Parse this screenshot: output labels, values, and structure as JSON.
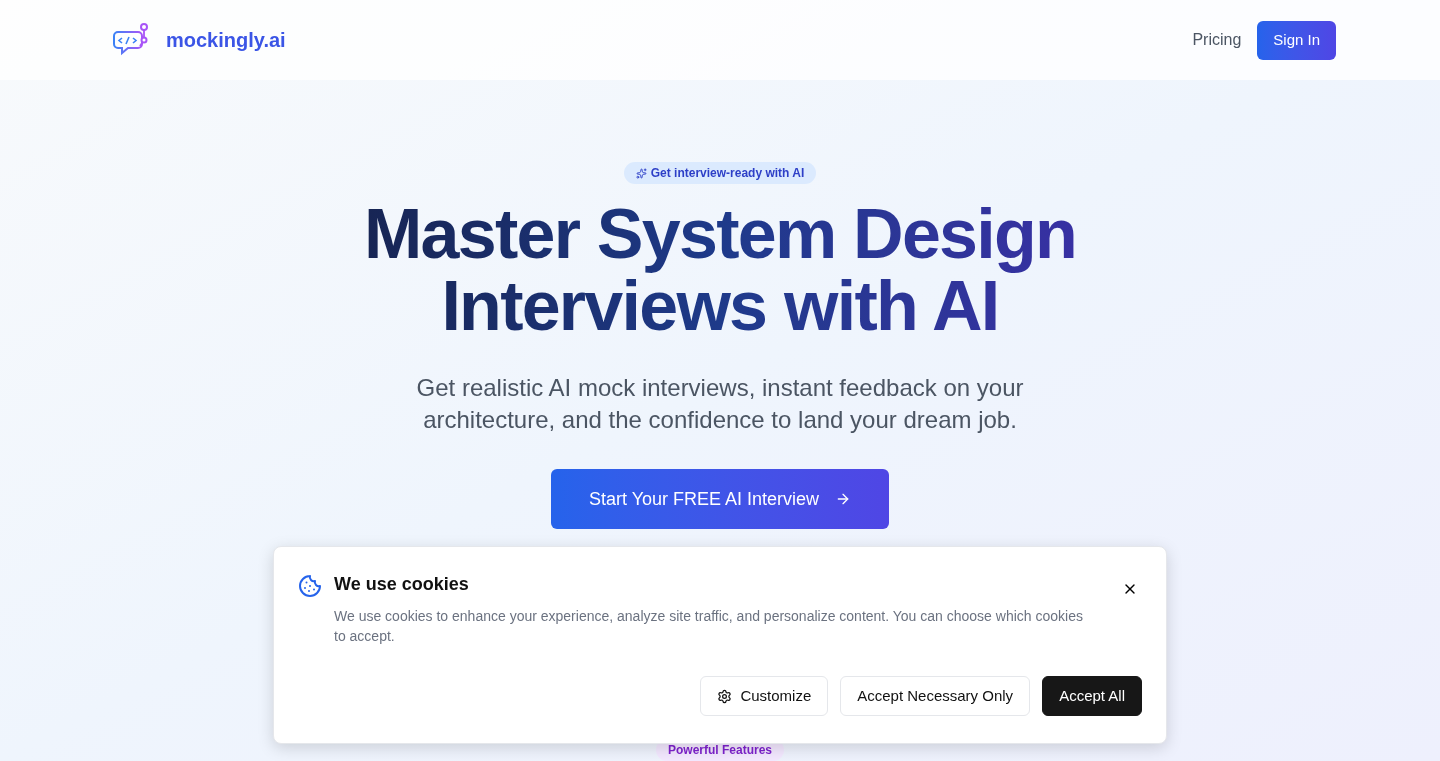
{
  "header": {
    "brand": "mockingly.ai",
    "nav": [
      {
        "kind": "link",
        "label": "Pricing"
      },
      {
        "kind": "button",
        "label": "Sign In"
      }
    ]
  },
  "hero": {
    "badge": "Get interview-ready with AI",
    "title_lines": [
      "Master System Design",
      "Interviews with AI"
    ],
    "subtitle": "Get realistic AI mock interviews, instant feedback on your architecture, and the confidence to land your dream job.",
    "cta": "Start Your FREE AI Interview"
  },
  "features_badge": "Powerful Features",
  "cookie_banner": {
    "title": "We use cookies",
    "text": "We use cookies to enhance your experience, analyze site traffic, and personalize content. You can choose which cookies to accept.",
    "buttons": [
      {
        "kind": "settings",
        "label": "Customize"
      },
      {
        "kind": "outline",
        "label": "Accept Necessary Only"
      },
      {
        "kind": "primary",
        "label": "Accept All"
      }
    ]
  }
}
